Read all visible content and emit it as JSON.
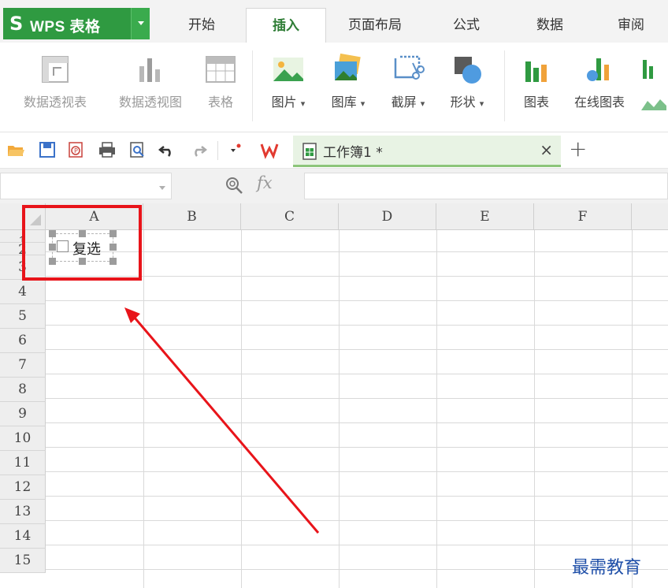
{
  "app": {
    "logo": "S",
    "title": "WPS 表格"
  },
  "ribbon_tabs": [
    "开始",
    "插入",
    "页面布局",
    "公式",
    "数据",
    "审阅"
  ],
  "active_tab": "插入",
  "ribbon": {
    "pivot_table": "数据透视表",
    "pivot_chart": "数据透视图",
    "table": "表格",
    "picture": "图片",
    "gallery": "图库",
    "screenshot": "截屏",
    "shapes": "形状",
    "chart": "图表",
    "online_chart": "在线图表",
    "dropdown_marker": "▾"
  },
  "document": {
    "tab_name": "工作簿1 *",
    "close": "×",
    "new_tab": "+"
  },
  "formula_bar": {
    "fx": "fx",
    "name_box_value": "",
    "formula_value": ""
  },
  "grid": {
    "columns": [
      "A",
      "B",
      "C",
      "D",
      "E",
      "F"
    ],
    "rows": [
      "1",
      "2",
      "3",
      "4",
      "5",
      "6",
      "7",
      "8",
      "9",
      "10",
      "11",
      "12",
      "13",
      "14",
      "15"
    ]
  },
  "checkbox_control": {
    "label": "复选",
    "checked": false
  },
  "watermark": "最需教育",
  "colors": {
    "wps_green": "#2f9a41",
    "active_tab_text": "#2f7d36",
    "highlight_red": "#e8141a",
    "watermark_blue": "#1f4fa8"
  },
  "icons": {
    "qat": [
      "open-folder-icon",
      "save-icon",
      "pdf-export-icon",
      "print-icon",
      "print-preview-icon",
      "undo-icon",
      "redo-icon",
      "customize-icon",
      "wps-logo-icon",
      "spreadsheet-doc-icon"
    ]
  }
}
